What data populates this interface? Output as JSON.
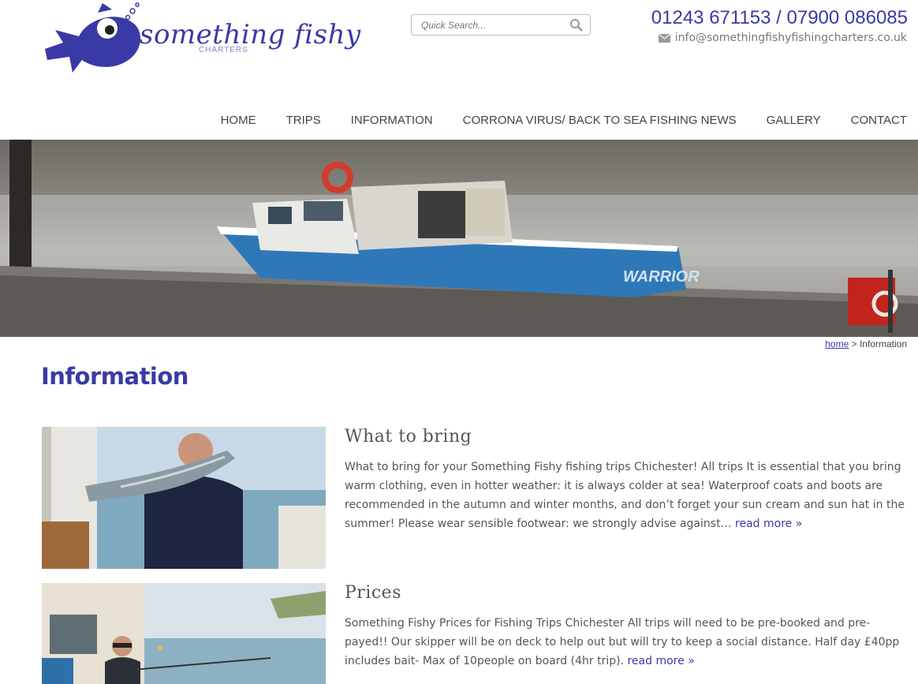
{
  "header": {
    "logo_text": "something fishy",
    "logo_sub": "CHARTERS",
    "phone": "01243 671153 / 07900 086085",
    "email": "info@somethingfishyfishingcharters.co.uk"
  },
  "search": {
    "placeholder": "Quick Search..."
  },
  "nav": {
    "items": [
      "HOME",
      "TRIPS",
      "INFORMATION",
      "CORRONA VIRUS/ BACK TO SEA FISHING NEWS",
      "GALLERY",
      "CONTACT"
    ]
  },
  "banner": {
    "boat_name": "WARRIOR"
  },
  "breadcrumb": {
    "home": "home",
    "sep": ">",
    "current": "Information"
  },
  "page": {
    "title": "Information"
  },
  "articles": [
    {
      "title": "What to bring",
      "text": "What to bring for your Something Fishy fishing trips Chichester! All trips It is essential that you bring warm clothing, even in hotter weather: it is always colder at sea! Waterproof coats and boots are recommended in the autumn and winter months, and don’t forget your sun cream and sun hat in the summer! Please wear sensible footwear: we strongly advise against…",
      "more": "read more »"
    },
    {
      "title": "Prices",
      "text": "Something Fishy Prices for Fishing Trips Chichester All trips will need to be pre-booked and pre-payed!! Our skipper will be on deck to help out but will try to keep a social distance. Half day £40pp includes bait- Max of 10people on board (4hr trip).",
      "more": "read more »"
    }
  ],
  "colors": {
    "brand": "#3a3aa6",
    "text": "#555555"
  }
}
